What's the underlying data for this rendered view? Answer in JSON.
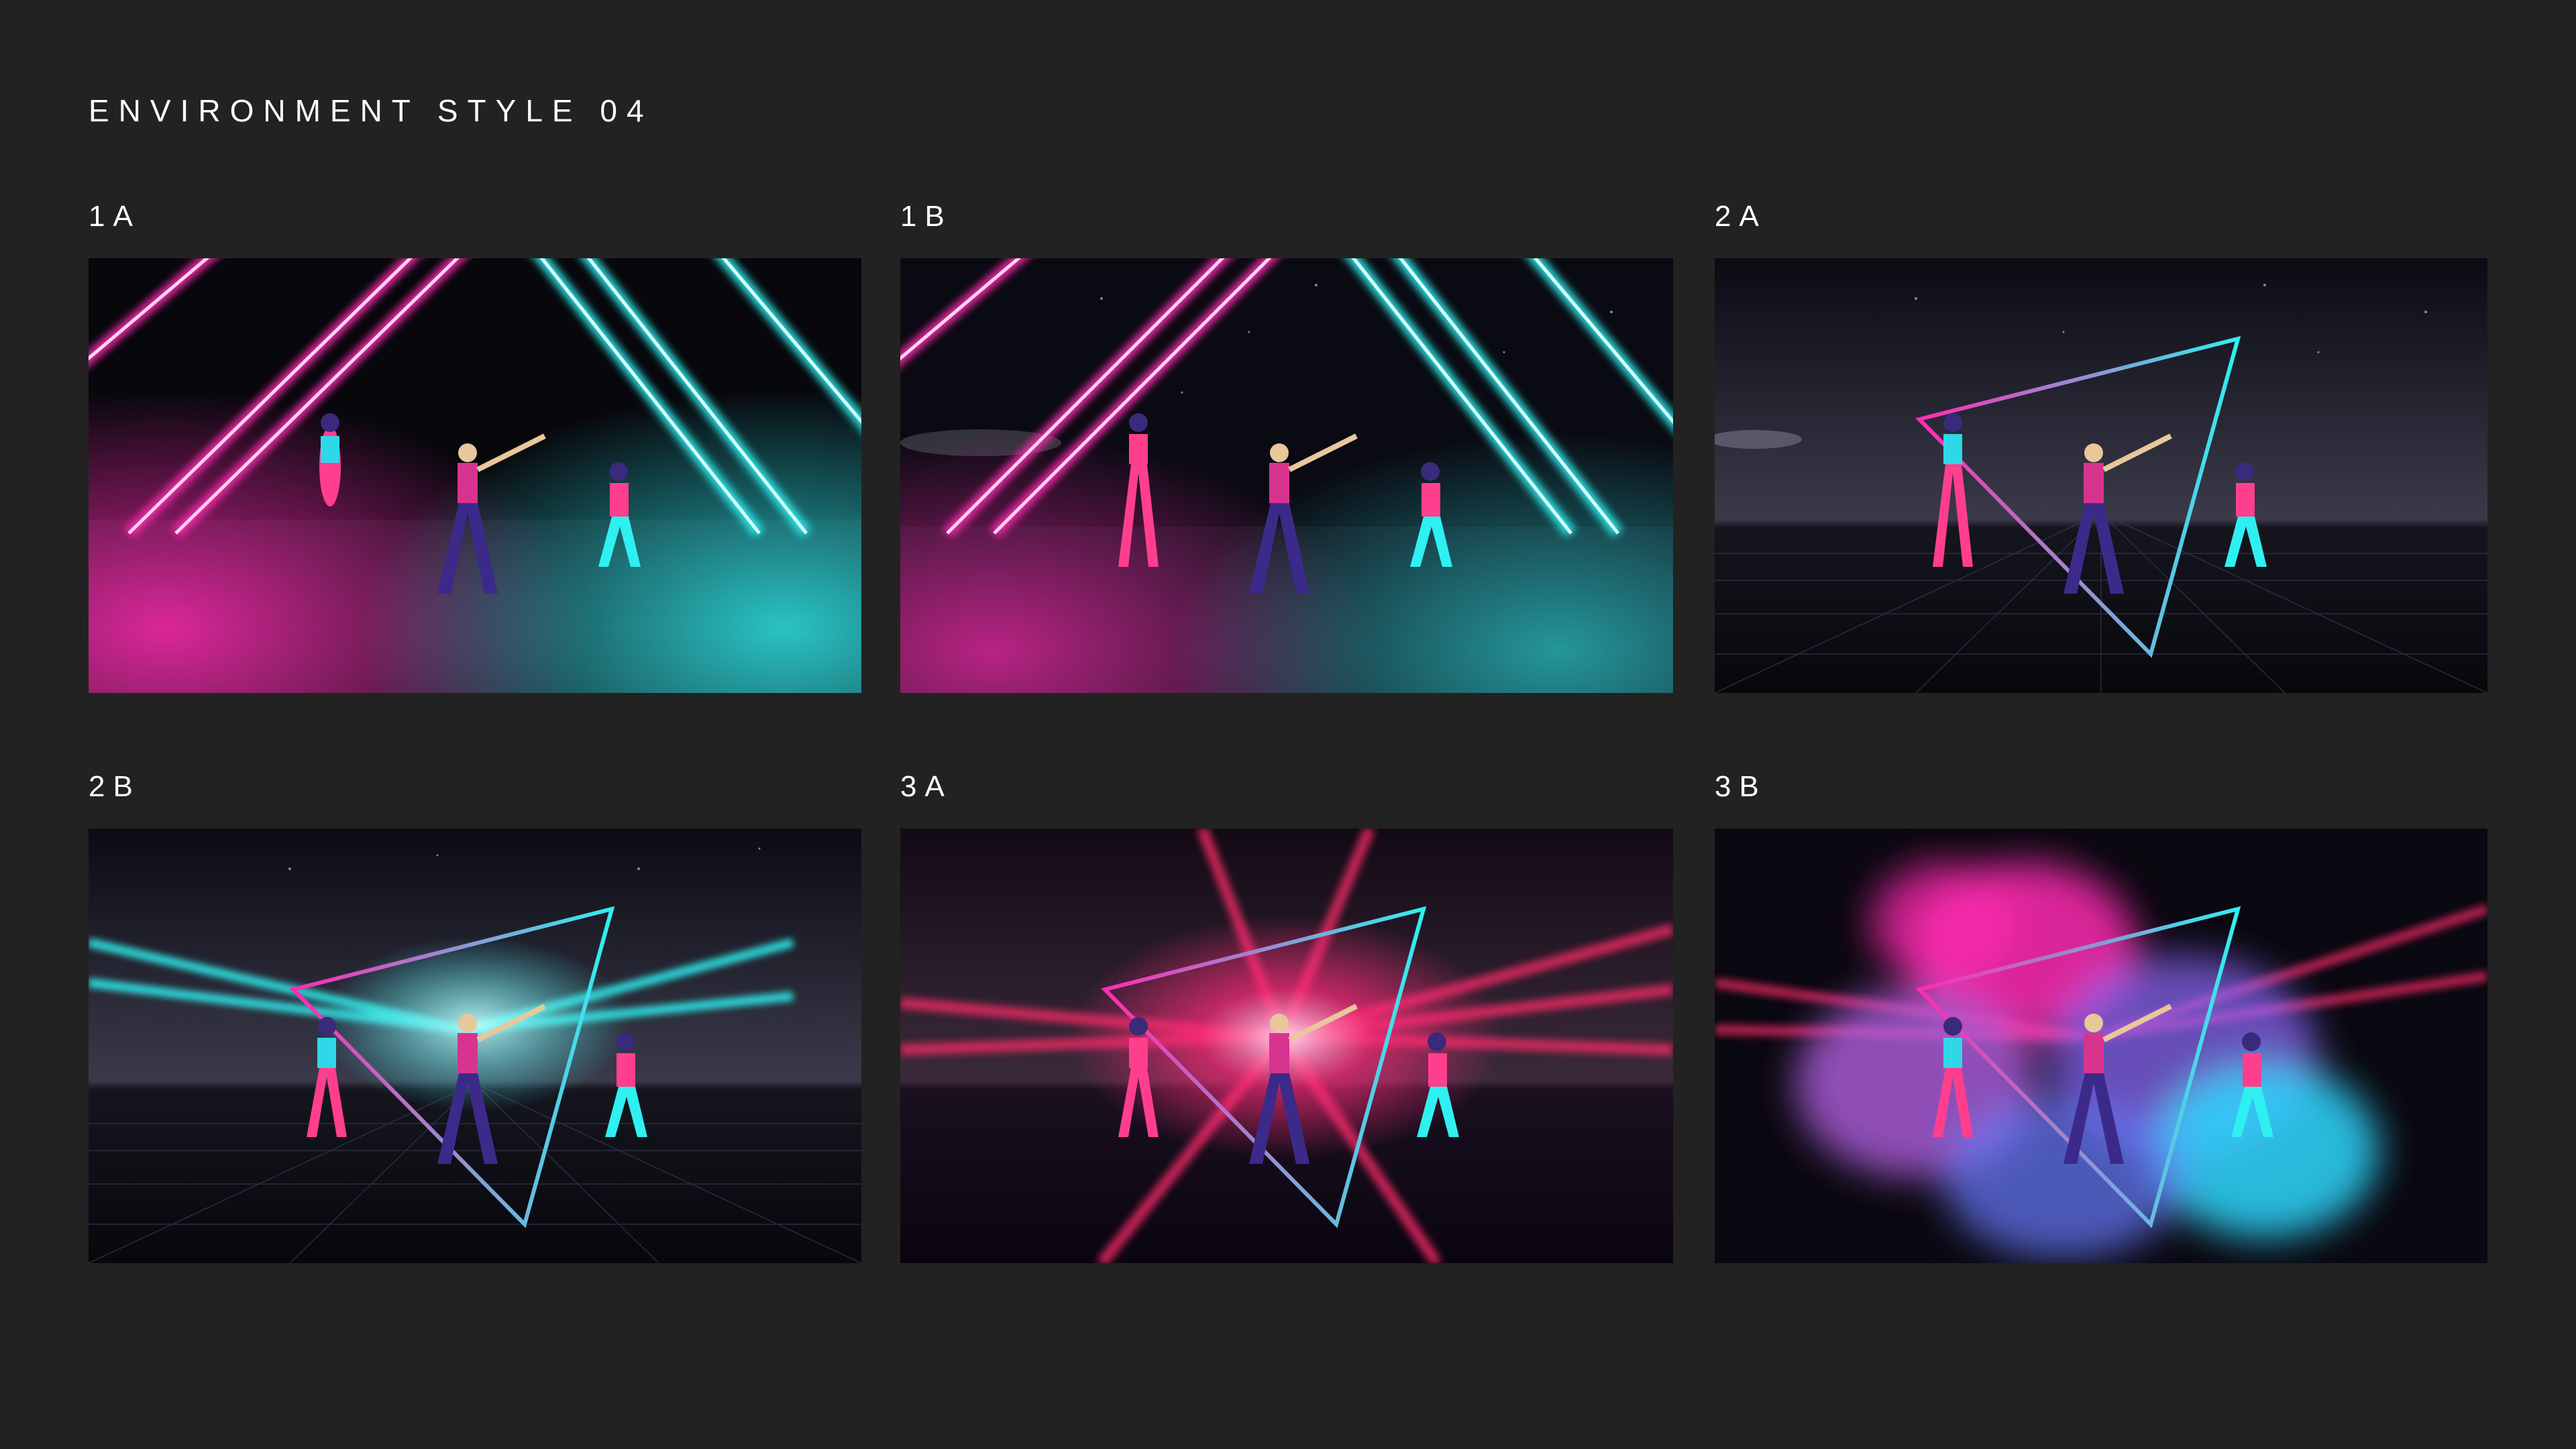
{
  "page": {
    "title": "ENVIRONMENT STYLE 04"
  },
  "panels": [
    {
      "label": "1A",
      "variant": "neon-room"
    },
    {
      "label": "1B",
      "variant": "neon-space"
    },
    {
      "label": "2A",
      "variant": "grid-triangle"
    },
    {
      "label": "2B",
      "variant": "grid-cyan-beams"
    },
    {
      "label": "3A",
      "variant": "grid-pink-burst"
    },
    {
      "label": "3B",
      "variant": "grid-color-smoke"
    }
  ],
  "colors": {
    "background": "#222222",
    "pink": "#ff2bb0",
    "cyan": "#2ff0f0",
    "purple": "#5a2aa8"
  }
}
